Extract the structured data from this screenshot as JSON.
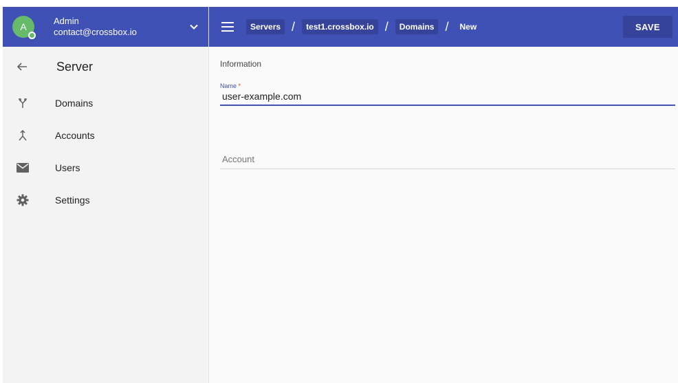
{
  "user": {
    "avatar_initial": "A",
    "name": "Admin",
    "email": "contact@crossbox.io"
  },
  "sidebar": {
    "title": "Server",
    "items": [
      {
        "label": "Domains",
        "icon": "domains-fork-icon"
      },
      {
        "label": "Accounts",
        "icon": "accounts-merge-icon"
      },
      {
        "label": "Users",
        "icon": "mail-icon"
      },
      {
        "label": "Settings",
        "icon": "gear-icon"
      }
    ]
  },
  "topbar": {
    "breadcrumbs": [
      "Servers",
      "test1.crossbox.io",
      "Domains",
      "New"
    ],
    "separator": "/",
    "save_label": "SAVE"
  },
  "form": {
    "section_title": "Information",
    "name_label": "Name",
    "name_required": "*",
    "name_value": "user-example.com",
    "account_placeholder": "Account"
  },
  "colors": {
    "primary": "#3f51b5",
    "primary_dark": "#35449a",
    "avatar": "#66bb6a",
    "required": "#e53935"
  }
}
